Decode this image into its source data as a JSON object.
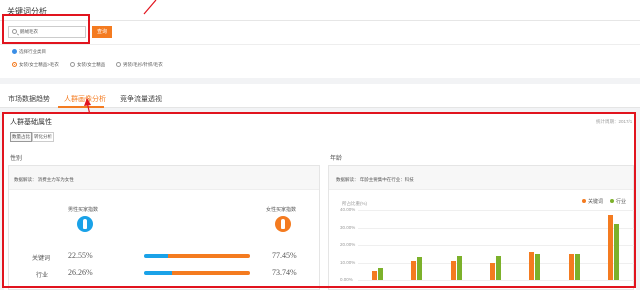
{
  "header": {
    "title": "关键词分析"
  },
  "search": {
    "value": "鹅绒毛衣",
    "button": "查询"
  },
  "industry": {
    "label": "选择行业类目",
    "options": [
      "女装/女士精品>毛衣",
      "女装/女士精品",
      "男装/毛衫/针织/毛衣"
    ],
    "selected_index": 0
  },
  "tabs": [
    {
      "label": "市场数据趋势",
      "active": false
    },
    {
      "label": "人群画像分析",
      "active": true
    },
    {
      "label": "竞争流量透视",
      "active": false
    }
  ],
  "panel": {
    "title": "人群基础属性",
    "stats_time": "统计周期：2017/1",
    "segments": [
      {
        "label": "数量占比",
        "selected": true
      },
      {
        "label": "转化分析",
        "selected": false
      }
    ]
  },
  "gender": {
    "section_label": "性别",
    "interpretation": "数据解读： 消费主力军为女性",
    "male_label": "男性买家指数",
    "female_label": "女性买家指数",
    "rows": [
      {
        "label": "关键词",
        "male": "22.55%",
        "female": "77.45%",
        "male_value": 22.55
      },
      {
        "label": "行业",
        "male": "26.26%",
        "female": "73.74%",
        "male_value": 26.26
      }
    ],
    "colors": {
      "male": "#1aa2e8",
      "female": "#f47b20"
    }
  },
  "age": {
    "section_label": "年龄",
    "interpretation": "数据解读： 年龄主要集中在行业：科技",
    "unit_label": "所占比重(%)",
    "legend": [
      {
        "name": "关键词",
        "color": "#f47b20"
      },
      {
        "name": "行业",
        "color": "#7cb12b"
      }
    ]
  },
  "chart_data": {
    "type": "bar",
    "ylabel": "所占比重(%)",
    "ylim": [
      0,
      40
    ],
    "y_ticks": [
      "40.00%",
      "30.00%",
      "20.00%",
      "10.00%",
      "0.00%"
    ],
    "categories": [
      "",
      "",
      "",
      "",
      "",
      "",
      ""
    ],
    "series": [
      {
        "name": "关键词",
        "values": [
          5,
          11,
          11,
          10,
          16,
          15,
          37
        ]
      },
      {
        "name": "行业",
        "values": [
          7,
          13,
          14,
          14,
          15,
          15,
          32
        ]
      }
    ]
  }
}
